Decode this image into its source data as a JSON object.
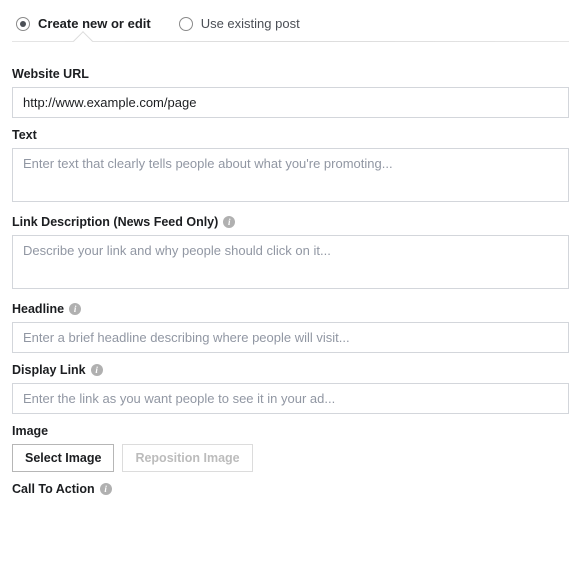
{
  "tabs": {
    "create_label": "Create new or edit",
    "existing_label": "Use existing post"
  },
  "fields": {
    "website_url": {
      "label": "Website URL",
      "value": "http://www.example.com/page"
    },
    "text": {
      "label": "Text",
      "placeholder": "Enter text that clearly tells people about what you're promoting..."
    },
    "link_description": {
      "label": "Link Description (News Feed Only)",
      "placeholder": "Describe your link and why people should click on it..."
    },
    "headline": {
      "label": "Headline",
      "placeholder": "Enter a brief headline describing where people will visit..."
    },
    "display_link": {
      "label": "Display Link",
      "placeholder": "Enter the link as you want people to see it in your ad..."
    },
    "image": {
      "label": "Image",
      "select_button": "Select Image",
      "reposition_button": "Reposition Image"
    },
    "cta": {
      "label": "Call To Action"
    }
  }
}
